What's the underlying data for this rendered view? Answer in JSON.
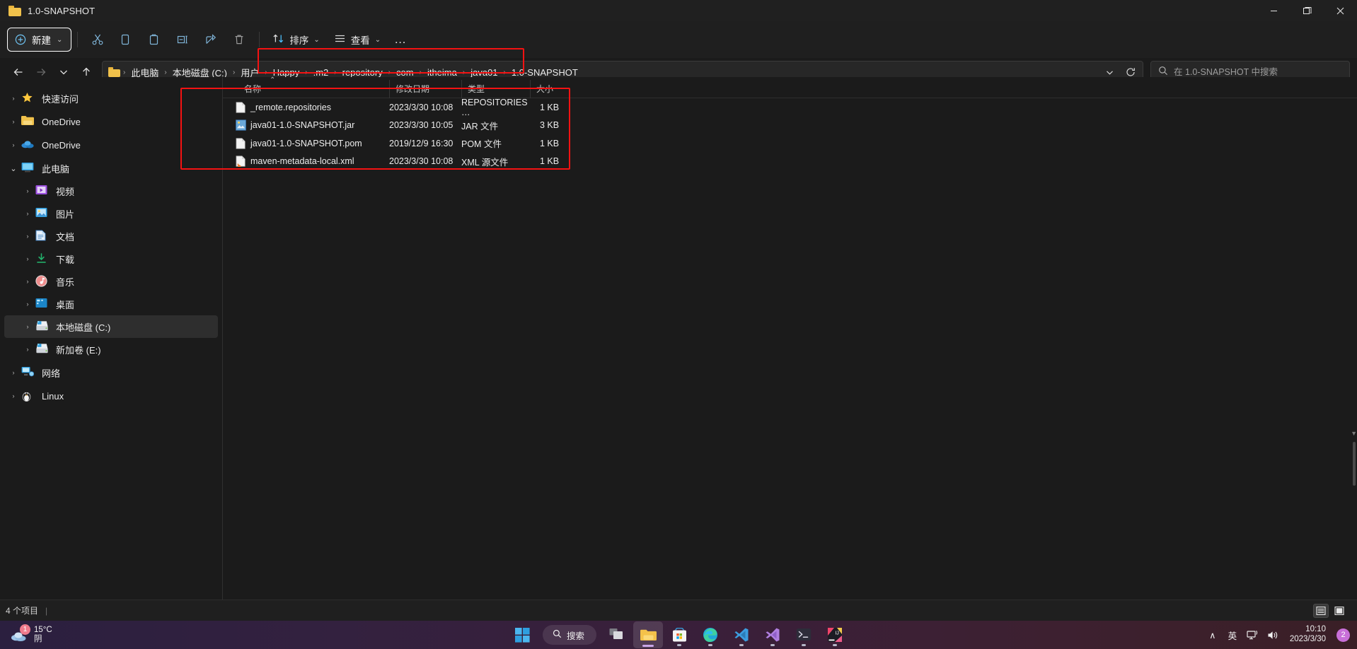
{
  "window": {
    "title": "1.0-SNAPSHOT",
    "folder_icon": "folder-icon",
    "minimize": "—",
    "maximize": "❐",
    "close": "✕"
  },
  "commandbar": {
    "new_label": "新建",
    "new_chevron": "⌄",
    "cut": "cut-icon",
    "copy": "copy-icon",
    "paste": "paste-icon",
    "rename": "rename-icon",
    "share": "share-icon",
    "delete": "delete-icon",
    "sort_label": "排序",
    "sort_chevron": "⌄",
    "view_label": "查看",
    "view_chevron": "⌄",
    "more_label": "…"
  },
  "address": {
    "back": "←",
    "forward": "→",
    "recent_chevron": "⌄",
    "up": "↑",
    "crumbs": [
      "此电脑",
      "本地磁盘 (C:)",
      "用户",
      "Happy",
      ".m2",
      "repository",
      "com",
      "itheima",
      "java01",
      "1.0-SNAPSHOT"
    ],
    "separator": "›",
    "dropdown_chevron": "⌄",
    "refresh": "refresh-icon",
    "search_placeholder": "在 1.0-SNAPSHOT 中搜索",
    "search_value": ""
  },
  "sidebar": {
    "items": [
      {
        "label": "快速访问",
        "icon": "star-icon",
        "level": 0,
        "twisty": "collapsed",
        "selected": false
      },
      {
        "label": "OneDrive",
        "icon": "folder-icon",
        "level": 0,
        "twisty": "collapsed",
        "selected": false
      },
      {
        "label": "OneDrive",
        "icon": "cloud-icon",
        "level": 0,
        "twisty": "collapsed",
        "selected": false
      },
      {
        "label": "此电脑",
        "icon": "monitor-icon",
        "level": 0,
        "twisty": "expanded",
        "selected": false
      },
      {
        "label": "视频",
        "icon": "video-icon",
        "level": 1,
        "twisty": "collapsed",
        "selected": false
      },
      {
        "label": "图片",
        "icon": "picture-icon",
        "level": 1,
        "twisty": "collapsed",
        "selected": false
      },
      {
        "label": "文档",
        "icon": "document-icon",
        "level": 1,
        "twisty": "collapsed",
        "selected": false
      },
      {
        "label": "下载",
        "icon": "download-icon",
        "level": 1,
        "twisty": "collapsed",
        "selected": false
      },
      {
        "label": "音乐",
        "icon": "music-icon",
        "level": 1,
        "twisty": "collapsed",
        "selected": false
      },
      {
        "label": "桌面",
        "icon": "desktop-icon",
        "level": 1,
        "twisty": "collapsed",
        "selected": false
      },
      {
        "label": "本地磁盘 (C:)",
        "icon": "drive-icon",
        "level": 1,
        "twisty": "collapsed",
        "selected": true
      },
      {
        "label": "新加卷 (E:)",
        "icon": "drive-icon",
        "level": 1,
        "twisty": "collapsed",
        "selected": false
      },
      {
        "label": "网络",
        "icon": "network-icon",
        "level": 0,
        "twisty": "collapsed",
        "selected": false
      },
      {
        "label": "Linux",
        "icon": "penguin-icon",
        "level": 0,
        "twisty": "collapsed",
        "selected": false
      }
    ],
    "twisty_collapsed": "›",
    "twisty_expanded": "⌄"
  },
  "filelist": {
    "columns": [
      {
        "key": "name",
        "label": "名称"
      },
      {
        "key": "date",
        "label": "修改日期"
      },
      {
        "key": "type",
        "label": "类型"
      },
      {
        "key": "size",
        "label": "大小"
      }
    ],
    "sort_indicator": "⌃",
    "rows": [
      {
        "name": "_remote.repositories",
        "date": "2023/3/30 10:08",
        "type": "REPOSITORIES …",
        "size": "1 KB",
        "icon": "generic-file-icon"
      },
      {
        "name": "java01-1.0-SNAPSHOT.jar",
        "date": "2023/3/30 10:05",
        "type": "JAR 文件",
        "size": "3 KB",
        "icon": "jar-file-icon"
      },
      {
        "name": "java01-1.0-SNAPSHOT.pom",
        "date": "2019/12/9 16:30",
        "type": "POM 文件",
        "size": "1 KB",
        "icon": "generic-file-icon"
      },
      {
        "name": "maven-metadata-local.xml",
        "date": "2023/3/30 10:08",
        "type": "XML 源文件",
        "size": "1 KB",
        "icon": "xml-file-icon"
      }
    ]
  },
  "statusbar": {
    "count_text": "4 个项目",
    "separator": "|",
    "details_view": "details-view-icon",
    "large_icons_view": "large-icons-view-icon"
  },
  "taskbar": {
    "weather": {
      "temperature": "15°C",
      "condition": "阴",
      "badge": "1"
    },
    "start": "windows-start-icon",
    "search_label": "搜索",
    "apps": [
      {
        "name": "task-view-icon",
        "active": false,
        "running": false
      },
      {
        "name": "file-explorer-icon",
        "active": true,
        "running": true
      },
      {
        "name": "microsoft-store-icon",
        "active": false,
        "running": true
      },
      {
        "name": "microsoft-edge-icon",
        "active": false,
        "running": true
      },
      {
        "name": "vs-code-icon",
        "active": false,
        "running": true
      },
      {
        "name": "visual-studio-icon",
        "active": false,
        "running": true
      },
      {
        "name": "terminal-icon",
        "active": false,
        "running": true
      },
      {
        "name": "intellij-idea-icon",
        "active": false,
        "running": true
      }
    ],
    "tray": {
      "overflow_chevron": "∧",
      "ime_label": "英",
      "network": "network-tray-icon",
      "volume": "volume-tray-icon",
      "time": "10:10",
      "date": "2023/3/30",
      "notification_count": "2"
    }
  },
  "colors": {
    "accent": "#4cc2ff",
    "highlight_box": "#f41212",
    "window_bg": "#1b1b1b",
    "chrome_bg": "#202020",
    "folder_yellow": "#f0c14b"
  }
}
